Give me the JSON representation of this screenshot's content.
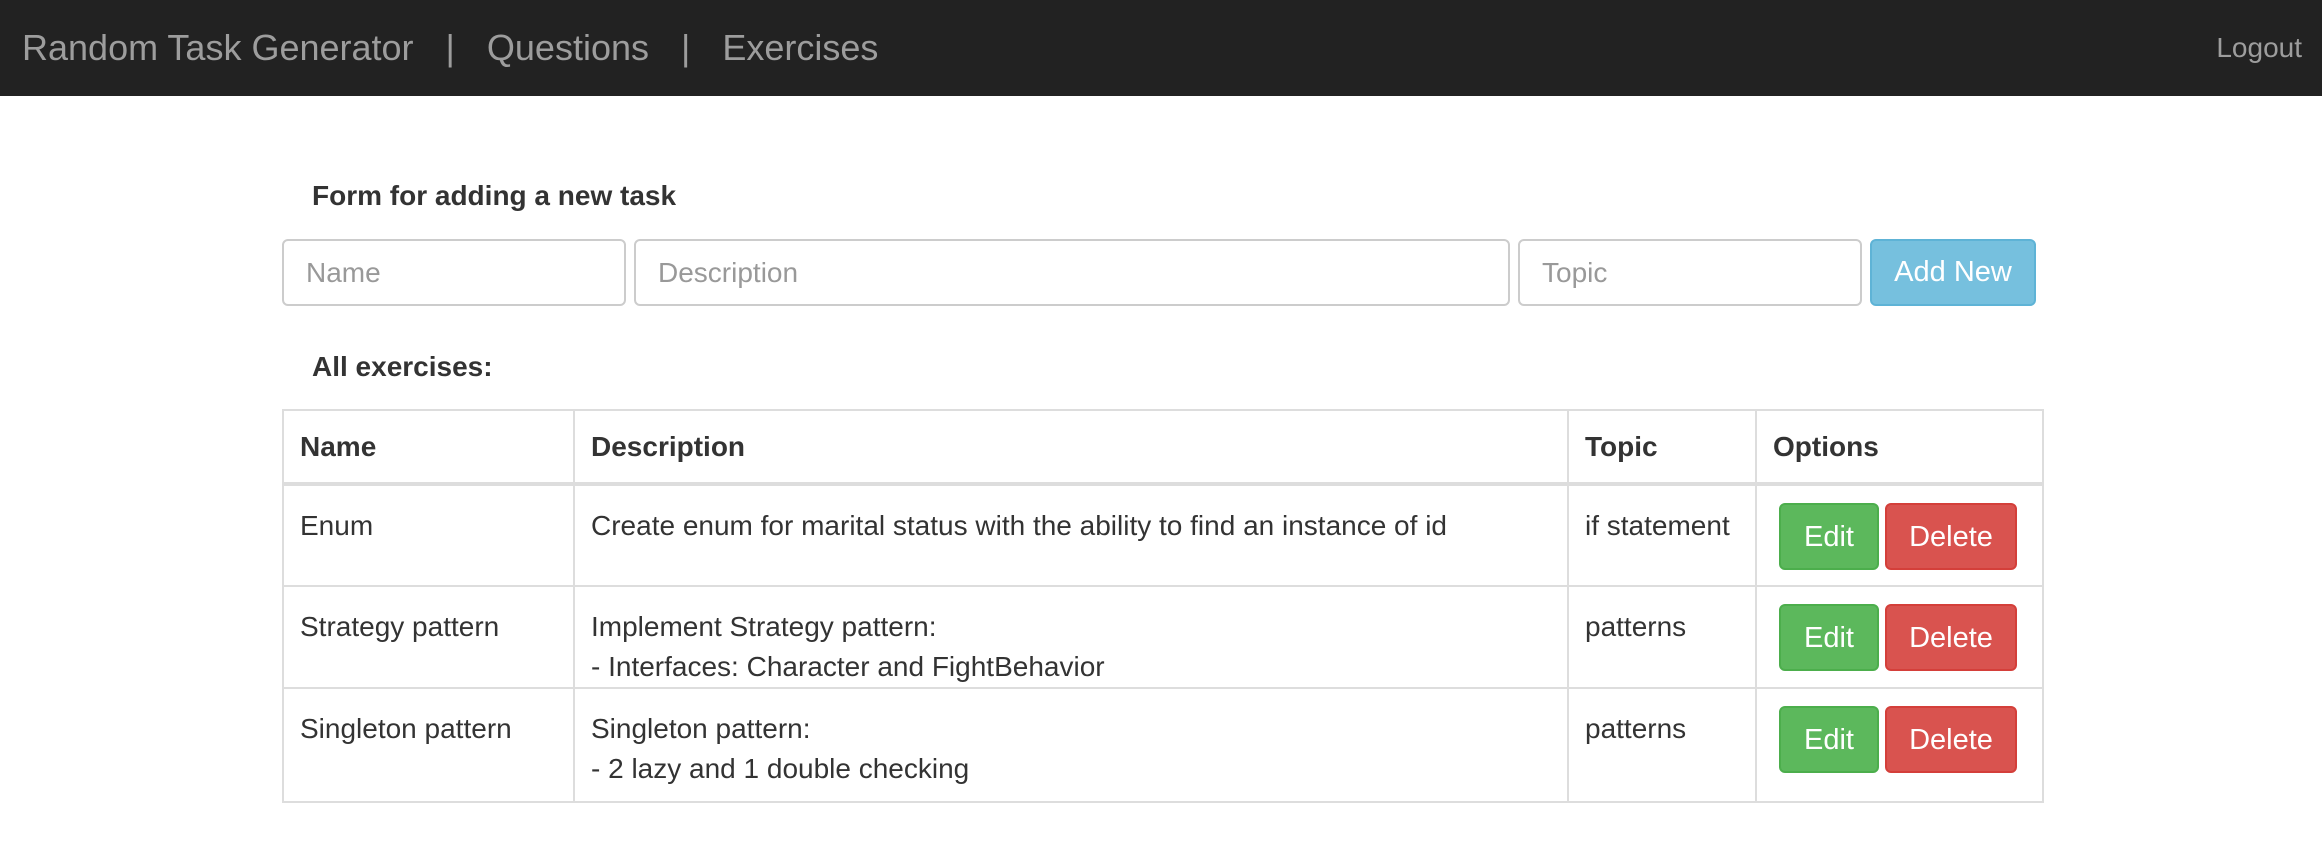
{
  "navbar": {
    "brand": "Random Task Generator",
    "separator": "|",
    "links": [
      "Questions",
      "Exercises"
    ],
    "logout": "Logout"
  },
  "form": {
    "title": "Form for adding a new task",
    "name_placeholder": "Name",
    "description_placeholder": "Description",
    "topic_placeholder": "Topic",
    "add_button": "Add New"
  },
  "table": {
    "title": "All exercises:",
    "headers": [
      "Name",
      "Description",
      "Topic",
      "Options"
    ],
    "rows": [
      {
        "name": "Enum",
        "description": [
          "Create enum for marital status with the ability to find an instance of id"
        ],
        "topic": "if statement"
      },
      {
        "name": "Strategy pattern",
        "description": [
          "Implement Strategy pattern:",
          "- Interfaces: Character and FightBehavior"
        ],
        "topic": "patterns"
      },
      {
        "name": "Singleton pattern",
        "description": [
          "Singleton pattern:",
          "- 2 lazy and 1 double checking"
        ],
        "topic": "patterns"
      }
    ],
    "edit_label": "Edit",
    "delete_label": "Delete"
  },
  "colors": {
    "navbar_bg": "#222222",
    "add_button": "#76c0de",
    "edit_button": "#5cb85c",
    "delete_button": "#d9534f"
  }
}
